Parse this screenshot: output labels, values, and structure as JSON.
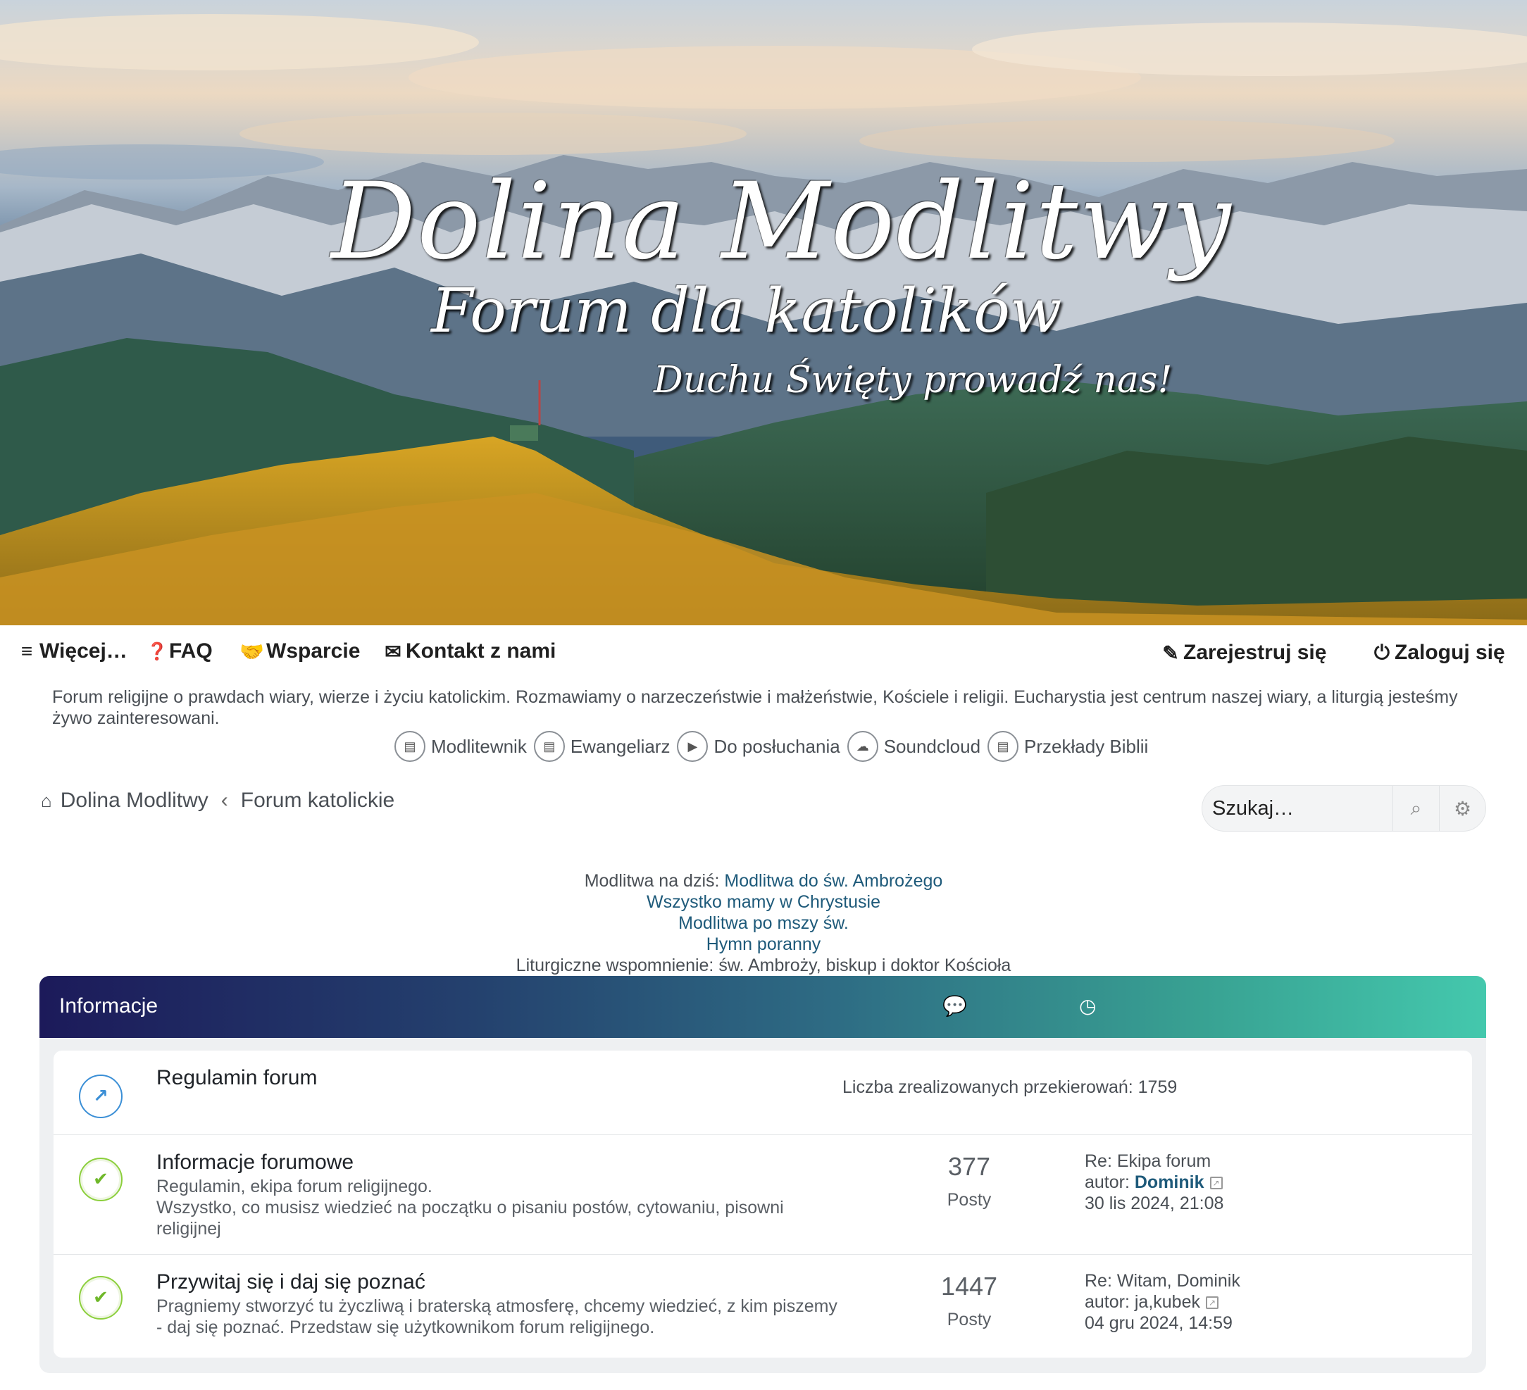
{
  "banner": {
    "title": "Dolina Modlitwy",
    "subtitle": "Forum dla katolików",
    "motto": "Duchu Święty prowadź nas!"
  },
  "nav": {
    "more": "Więcej…",
    "faq": "FAQ",
    "support": "Wsparcie",
    "contact": "Kontakt z nami",
    "register": "Zarejestruj się",
    "login": "Zaloguj się"
  },
  "site_description": "Forum religijne o prawdach wiary, wierze i życiu katolickim. Rozmawiamy o narzeczeństwie i małżeństwie, Kościele i religii. Eucharystia jest centrum naszej wiary, a liturgią jesteśmy żywo zainteresowani.",
  "quicklinks": [
    {
      "label": "Modlitewnik",
      "icon": "book-icon"
    },
    {
      "label": "Ewangeliarz",
      "icon": "book-icon"
    },
    {
      "label": "Do posłuchania",
      "icon": "youtube-icon"
    },
    {
      "label": "Soundcloud",
      "icon": "soundcloud-icon"
    },
    {
      "label": "Przekłady Biblii",
      "icon": "book-icon"
    }
  ],
  "breadcrumb": {
    "home": "Dolina Modlitwy",
    "current": "Forum katolickie"
  },
  "search": {
    "placeholder": "Szukaj…"
  },
  "prayers": {
    "today_label": "Modlitwa na dziś:",
    "today_link": "Modlitwa do św. Ambrożego",
    "link2": "Wszystko mamy w Chrystusie",
    "link3": "Modlitwa po mszy św.",
    "link4": "Hymn poranny",
    "liturgical": "Liturgiczne wspomnienie: św. Ambroży, biskup i doktor Kościoła"
  },
  "forum": {
    "header_title": "Informacje",
    "rows": [
      {
        "title": "Regulamin forum",
        "redirect": "Liczba zrealizowanych przekierowań: 1759",
        "icon": "external-link-icon"
      },
      {
        "title": "Informacje forumowe",
        "desc1": "Regulamin, ekipa forum religijnego.",
        "desc2": "Wszystko, co musisz wiedzieć na początku o pisaniu postów, cytowaniu, pisowni religijnej",
        "posts": "377",
        "posts_label": "Posty",
        "last_title": "Re: Ekipa forum",
        "author_prefix": "autor: ",
        "author": "Dominik",
        "date": "30 lis 2024, 21:08",
        "icon": "check-icon"
      },
      {
        "title": "Przywitaj się i daj się poznać",
        "desc1": "Pragniemy stworzyć tu życzliwą i braterską atmosferę, chcemy wiedzieć, z kim piszemy - daj się poznać. Przedstaw się użytkownikom forum religijnego.",
        "posts": "1447",
        "posts_label": "Posty",
        "last_title": "Re: Witam, Dominik",
        "author_prefix": "autor: ",
        "author": "ja,kubek",
        "date": "04 gru 2024, 14:59",
        "icon": "check-icon"
      }
    ]
  },
  "colors": {
    "link": "#1e5a7a",
    "header_start": "#1c1a5a",
    "header_end": "#44c8ad",
    "read_icon": "#8ccf3d"
  }
}
